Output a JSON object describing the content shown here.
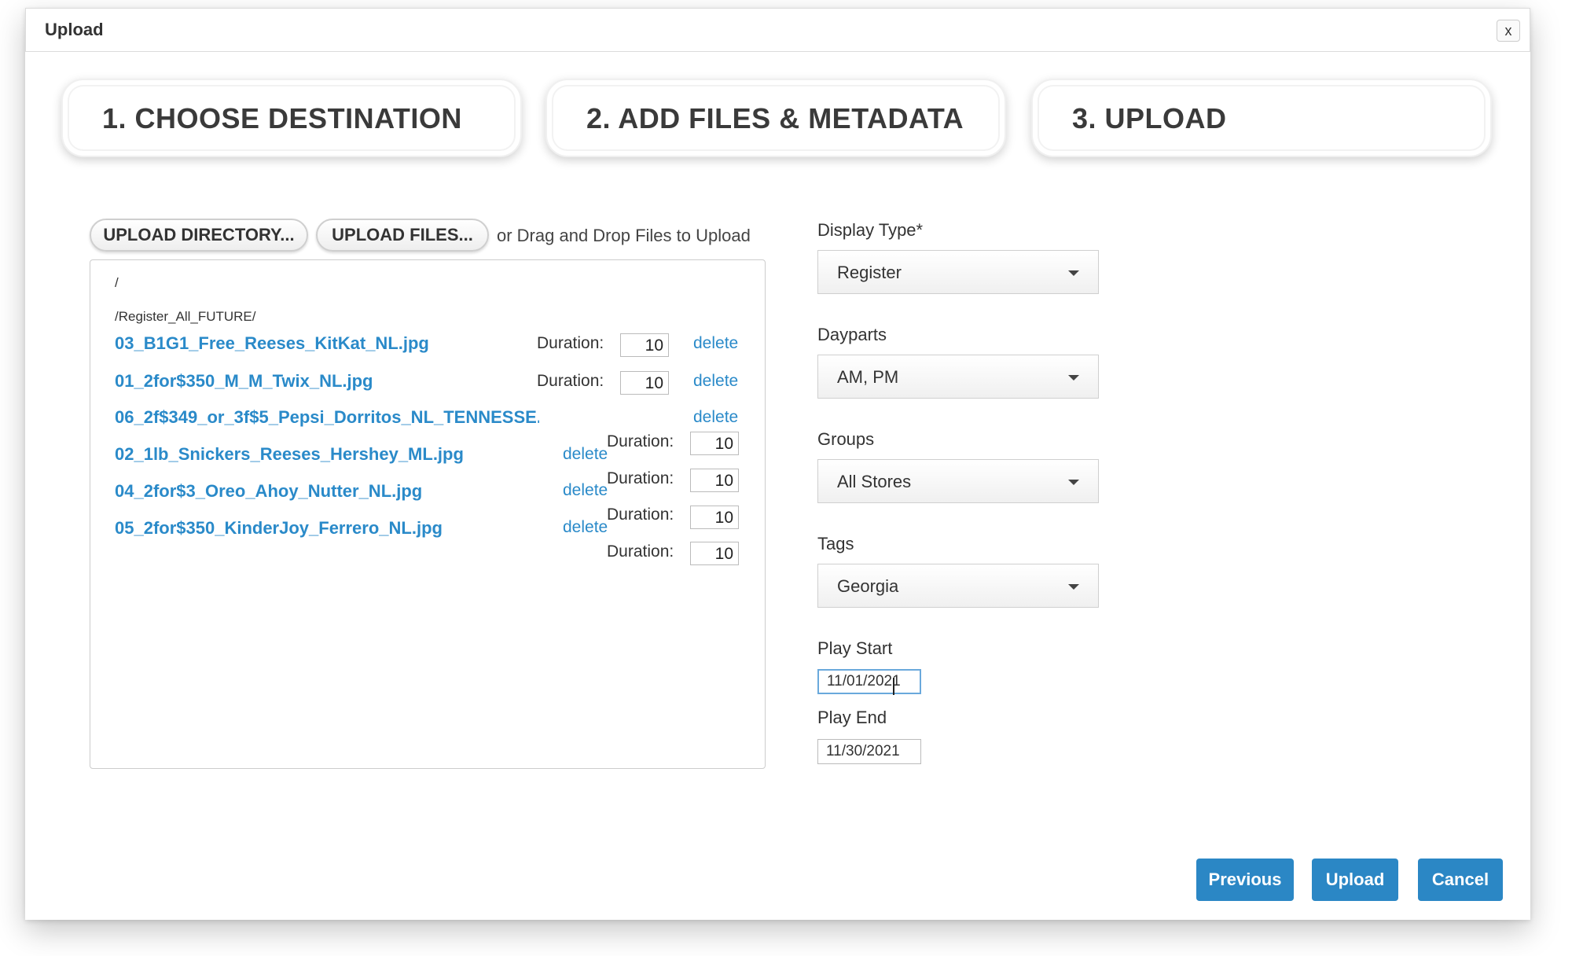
{
  "dialog": {
    "title": "Upload",
    "close_label": "x"
  },
  "steps": [
    {
      "label": "1. CHOOSE DESTINATION"
    },
    {
      "label": "2. ADD FILES & METADATA"
    },
    {
      "label": "3. UPLOAD"
    }
  ],
  "upload": {
    "directory_button": "UPLOAD DIRECTORY...",
    "files_button": "UPLOAD FILES...",
    "drag_hint": "or Drag and Drop Files to Upload"
  },
  "file_list": {
    "root_path": "/",
    "folder_path": "/Register_All_FUTURE/",
    "duration_label": "Duration:",
    "delete_label": "delete",
    "files": [
      {
        "name": "03_B1G1_Free_Reeses_KitKat_NL.jpg",
        "duration": "10"
      },
      {
        "name": "01_2for$350_M_M_Twix_NL.jpg",
        "duration": "10"
      },
      {
        "name": "06_2f$349_or_3f$5_Pepsi_Dorritos_NL_TENNESSE..."
      },
      {
        "name": "02_1lb_Snickers_Reeses_Hershey_ML.jpg"
      },
      {
        "name": "04_2for$3_Oreo_Ahoy_Nutter_NL.jpg"
      },
      {
        "name": "05_2for$350_KinderJoy_Ferrero_NL.jpg"
      }
    ],
    "extra_durations": [
      "10",
      "10",
      "10",
      "10"
    ]
  },
  "metadata": {
    "display_type": {
      "label": "Display Type*",
      "value": "Register"
    },
    "dayparts": {
      "label": "Dayparts",
      "value": "AM, PM"
    },
    "groups": {
      "label": "Groups",
      "value": "All Stores"
    },
    "tags": {
      "label": "Tags",
      "value": "Georgia"
    },
    "play_start": {
      "label": "Play Start",
      "value": "11/01/2021"
    },
    "play_end": {
      "label": "Play End",
      "value": "11/30/2021"
    }
  },
  "actions": {
    "previous": "Previous",
    "upload": "Upload",
    "cancel": "Cancel"
  },
  "colors": {
    "accent": "#2b87c5",
    "link": "#2a8ac9"
  }
}
